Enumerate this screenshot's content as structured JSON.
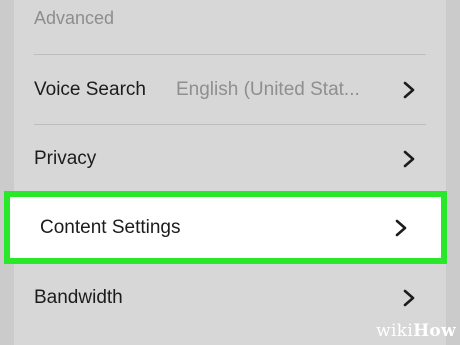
{
  "section": {
    "header": "Advanced"
  },
  "rows": [
    {
      "label": "Voice Search",
      "value": "English (United Stat...",
      "icon": "chevron-right-icon"
    },
    {
      "label": "Privacy",
      "icon": "chevron-right-icon"
    },
    {
      "label": "Content Settings",
      "icon": "chevron-right-icon",
      "highlighted": true
    },
    {
      "label": "Bandwidth",
      "icon": "chevron-right-icon"
    }
  ],
  "colors": {
    "highlight_border": "#29e829",
    "background": "#d7d7d7",
    "text": "#1c1c1c",
    "secondary_text": "#8f8f8f"
  },
  "watermark": {
    "prefix": "wiki",
    "suffix": "How"
  }
}
